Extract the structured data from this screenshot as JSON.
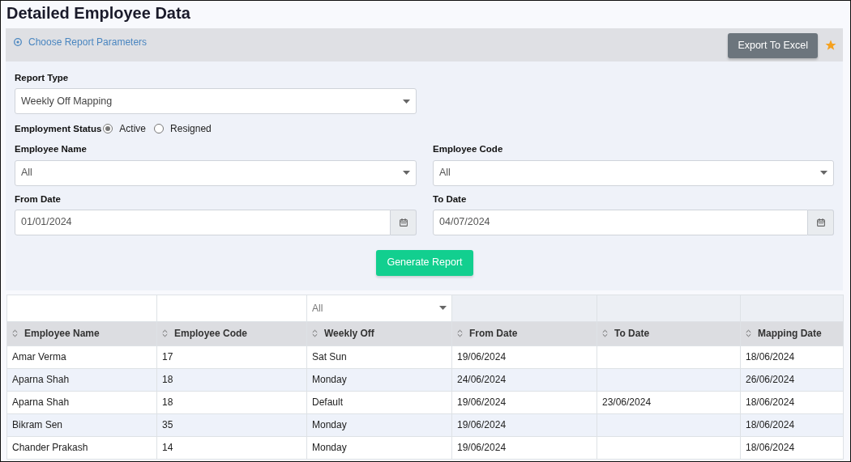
{
  "page": {
    "title": "Detailed Employee Data"
  },
  "panel": {
    "header_link": "Choose Report Parameters",
    "export_button": "Export To Excel",
    "favorite": true
  },
  "form": {
    "report_type": {
      "label": "Report Type",
      "value": "Weekly Off Mapping"
    },
    "employment_status": {
      "label": "Employment Status",
      "options": [
        {
          "label": "Active",
          "selected": true
        },
        {
          "label": "Resigned",
          "selected": false
        }
      ]
    },
    "fields": [
      {
        "kind": "select",
        "label": "Employee Name",
        "value": "All"
      },
      {
        "kind": "select",
        "label": "Employee Code",
        "value": "All"
      },
      {
        "kind": "date",
        "label": "From Date",
        "value": "01/01/2024"
      },
      {
        "kind": "date",
        "label": "To Date",
        "value": "04/07/2024"
      }
    ],
    "generate_button": "Generate Report"
  },
  "table": {
    "filters": [
      {
        "kind": "text"
      },
      {
        "kind": "text"
      },
      {
        "kind": "select",
        "value": "All"
      },
      {
        "kind": "none"
      },
      {
        "kind": "none"
      },
      {
        "kind": "none"
      }
    ],
    "columns": [
      "Employee Name",
      "Employee Code",
      "Weekly Off",
      "From Date",
      "To Date",
      "Mapping Date"
    ],
    "rows": [
      [
        "Amar Verma",
        "17",
        "Sat Sun",
        "19/06/2024",
        "",
        "18/06/2024"
      ],
      [
        "Aparna Shah",
        "18",
        "Monday",
        "24/06/2024",
        "",
        "26/06/2024"
      ],
      [
        "Aparna Shah",
        "18",
        "Default",
        "19/06/2024",
        "23/06/2024",
        "18/06/2024"
      ],
      [
        "Bikram Sen",
        "35",
        "Monday",
        "19/06/2024",
        "",
        "18/06/2024"
      ],
      [
        "Chander Prakash",
        "14",
        "Monday",
        "19/06/2024",
        "",
        "18/06/2024"
      ]
    ]
  }
}
